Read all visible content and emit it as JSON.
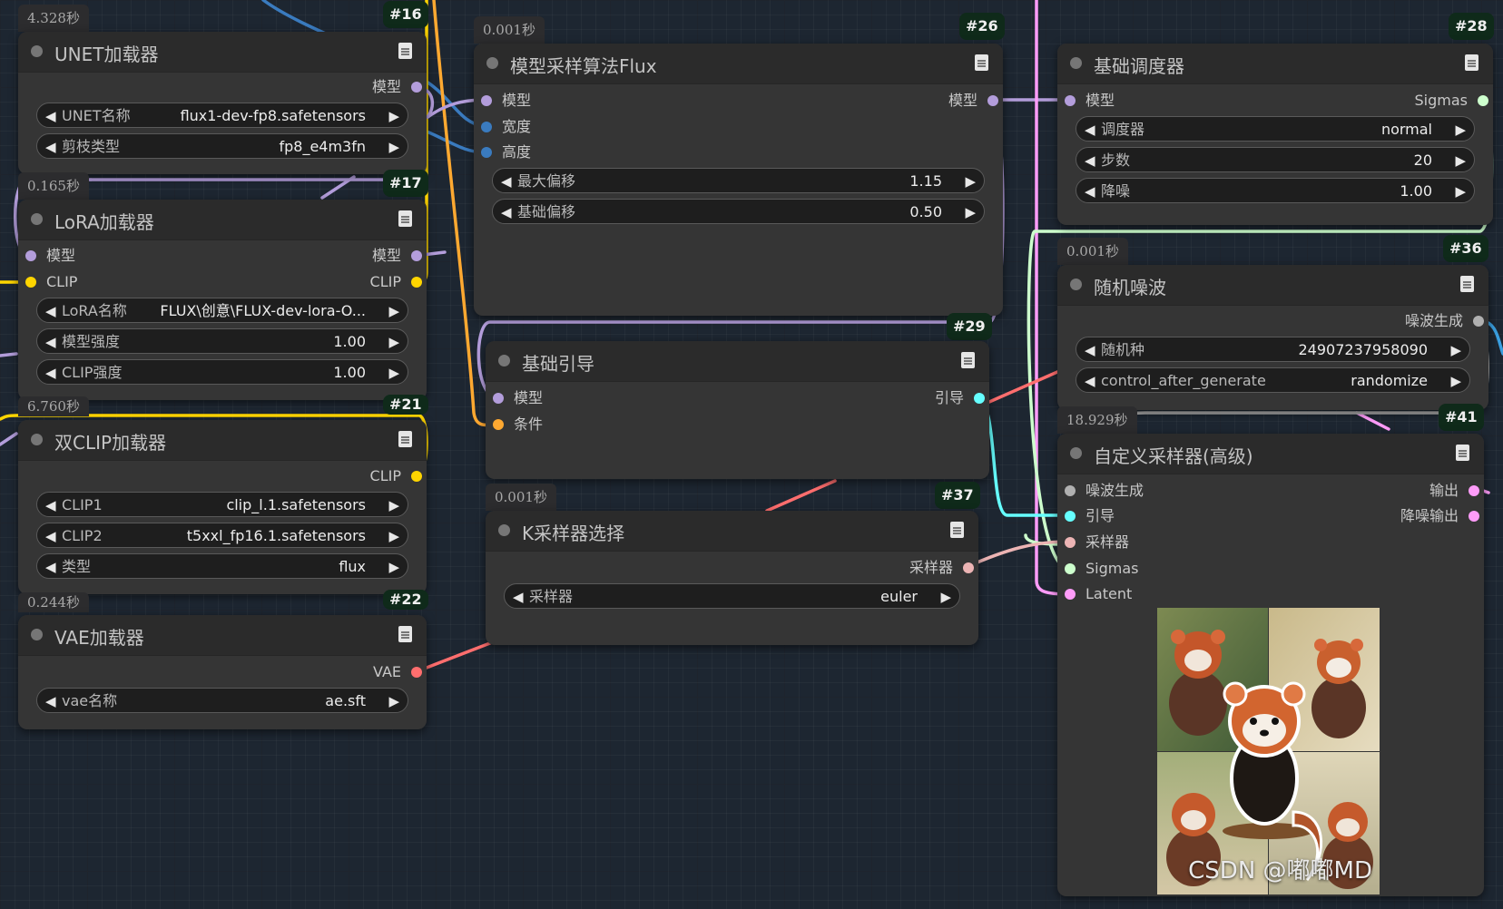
{
  "colors": {
    "model": "#b39ddb",
    "clip": "#ffd500",
    "vae": "#ff6e6e",
    "int": "#6a9fcf",
    "guider": "#66ffff",
    "sampler": "#ecb4b4",
    "sigmas": "#cdffcd",
    "latent": "#ff9cf9",
    "noise": "#b0b0b0",
    "conditioning": "#ffa931"
  },
  "nodes": {
    "unet": {
      "time": "4.328秒",
      "id": "#16",
      "title": "UNET加载器",
      "outputs": [
        "模型"
      ],
      "widgets": [
        {
          "label": "UNET名称",
          "value": "flux1-dev-fp8.safetensors"
        },
        {
          "label": "剪枝类型",
          "value": "fp8_e4m3fn"
        }
      ]
    },
    "lora": {
      "time": "0.165秒",
      "id": "#17",
      "title": "LoRA加载器",
      "inputs": [
        "模型",
        "CLIP"
      ],
      "outputs": [
        "模型",
        "CLIP"
      ],
      "widgets": [
        {
          "label": "LoRA名称",
          "value": "FLUX\\创意\\FLUX-dev-lora-O..."
        },
        {
          "label": "模型强度",
          "value": "1.00"
        },
        {
          "label": "CLIP强度",
          "value": "1.00"
        }
      ]
    },
    "dualclip": {
      "time": "6.760秒",
      "id": "#21",
      "title": "双CLIP加载器",
      "outputs": [
        "CLIP"
      ],
      "widgets": [
        {
          "label": "CLIP1",
          "value": "clip_l.1.safetensors"
        },
        {
          "label": "CLIP2",
          "value": "t5xxl_fp16.1.safetensors"
        },
        {
          "label": "类型",
          "value": "flux"
        }
      ]
    },
    "vae": {
      "time": "0.244秒",
      "id": "#22",
      "title": "VAE加载器",
      "outputs": [
        "VAE"
      ],
      "widgets": [
        {
          "label": "vae名称",
          "value": "ae.sft"
        }
      ]
    },
    "modelsampling": {
      "time": "0.001秒",
      "id": "#26",
      "title": "模型采样算法Flux",
      "inputs": [
        "模型",
        "宽度",
        "高度"
      ],
      "outputs": [
        "模型"
      ],
      "widgets": [
        {
          "label": "最大偏移",
          "value": "1.15"
        },
        {
          "label": "基础偏移",
          "value": "0.50"
        }
      ]
    },
    "guider": {
      "id": "#29",
      "title": "基础引导",
      "inputs": [
        "模型",
        "条件"
      ],
      "outputs": [
        "引导"
      ]
    },
    "ksamplersel": {
      "time": "0.001秒",
      "id": "#37",
      "title": "K采样器选择",
      "outputs": [
        "采样器"
      ],
      "widgets": [
        {
          "label": "采样器",
          "value": "euler"
        }
      ]
    },
    "scheduler": {
      "id": "#28",
      "title": "基础调度器",
      "inputs": [
        "模型"
      ],
      "outputs": [
        "Sigmas"
      ],
      "widgets": [
        {
          "label": "调度器",
          "value": "normal"
        },
        {
          "label": "步数",
          "value": "20"
        },
        {
          "label": "降噪",
          "value": "1.00"
        }
      ]
    },
    "noise": {
      "time": "0.001秒",
      "id": "#36",
      "title": "随机噪波",
      "outputs": [
        "噪波生成"
      ],
      "widgets": [
        {
          "label": "随机种",
          "value": "24907237958090"
        },
        {
          "label": "control_after_generate",
          "value": "randomize"
        }
      ]
    },
    "advsampler": {
      "time": "18.929秒",
      "id": "#41",
      "title": "自定义采样器(高级)",
      "inputs": [
        "噪波生成",
        "引导",
        "采样器",
        "Sigmas",
        "Latent"
      ],
      "outputs": [
        "输出",
        "降噪输出"
      ]
    }
  },
  "widget_arrows": {
    "left": "◀",
    "right": "▶"
  },
  "watermark": "CSDN @嘟嘟MD"
}
